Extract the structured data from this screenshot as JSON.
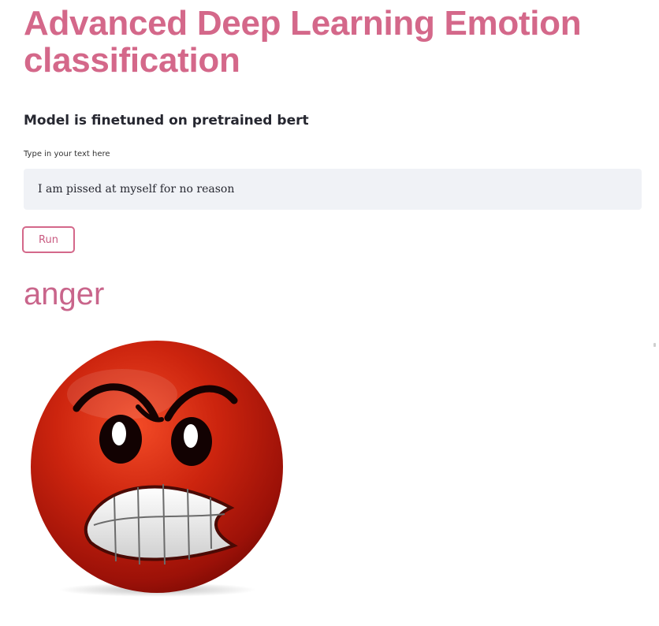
{
  "app": {
    "title": "Advanced Deep Learning Emotion classification",
    "subtitle": "Model is finetuned on pretrained bert"
  },
  "input": {
    "label": "Type in your text here",
    "value": "I am pissed at myself for no reason"
  },
  "run_button": {
    "label": "Run"
  },
  "result": {
    "emotion": "anger",
    "icon": "angry-face-icon"
  },
  "colors": {
    "accent": "#d4688a",
    "input_bg": "#f0f2f6",
    "face_red": "#c8200d"
  }
}
